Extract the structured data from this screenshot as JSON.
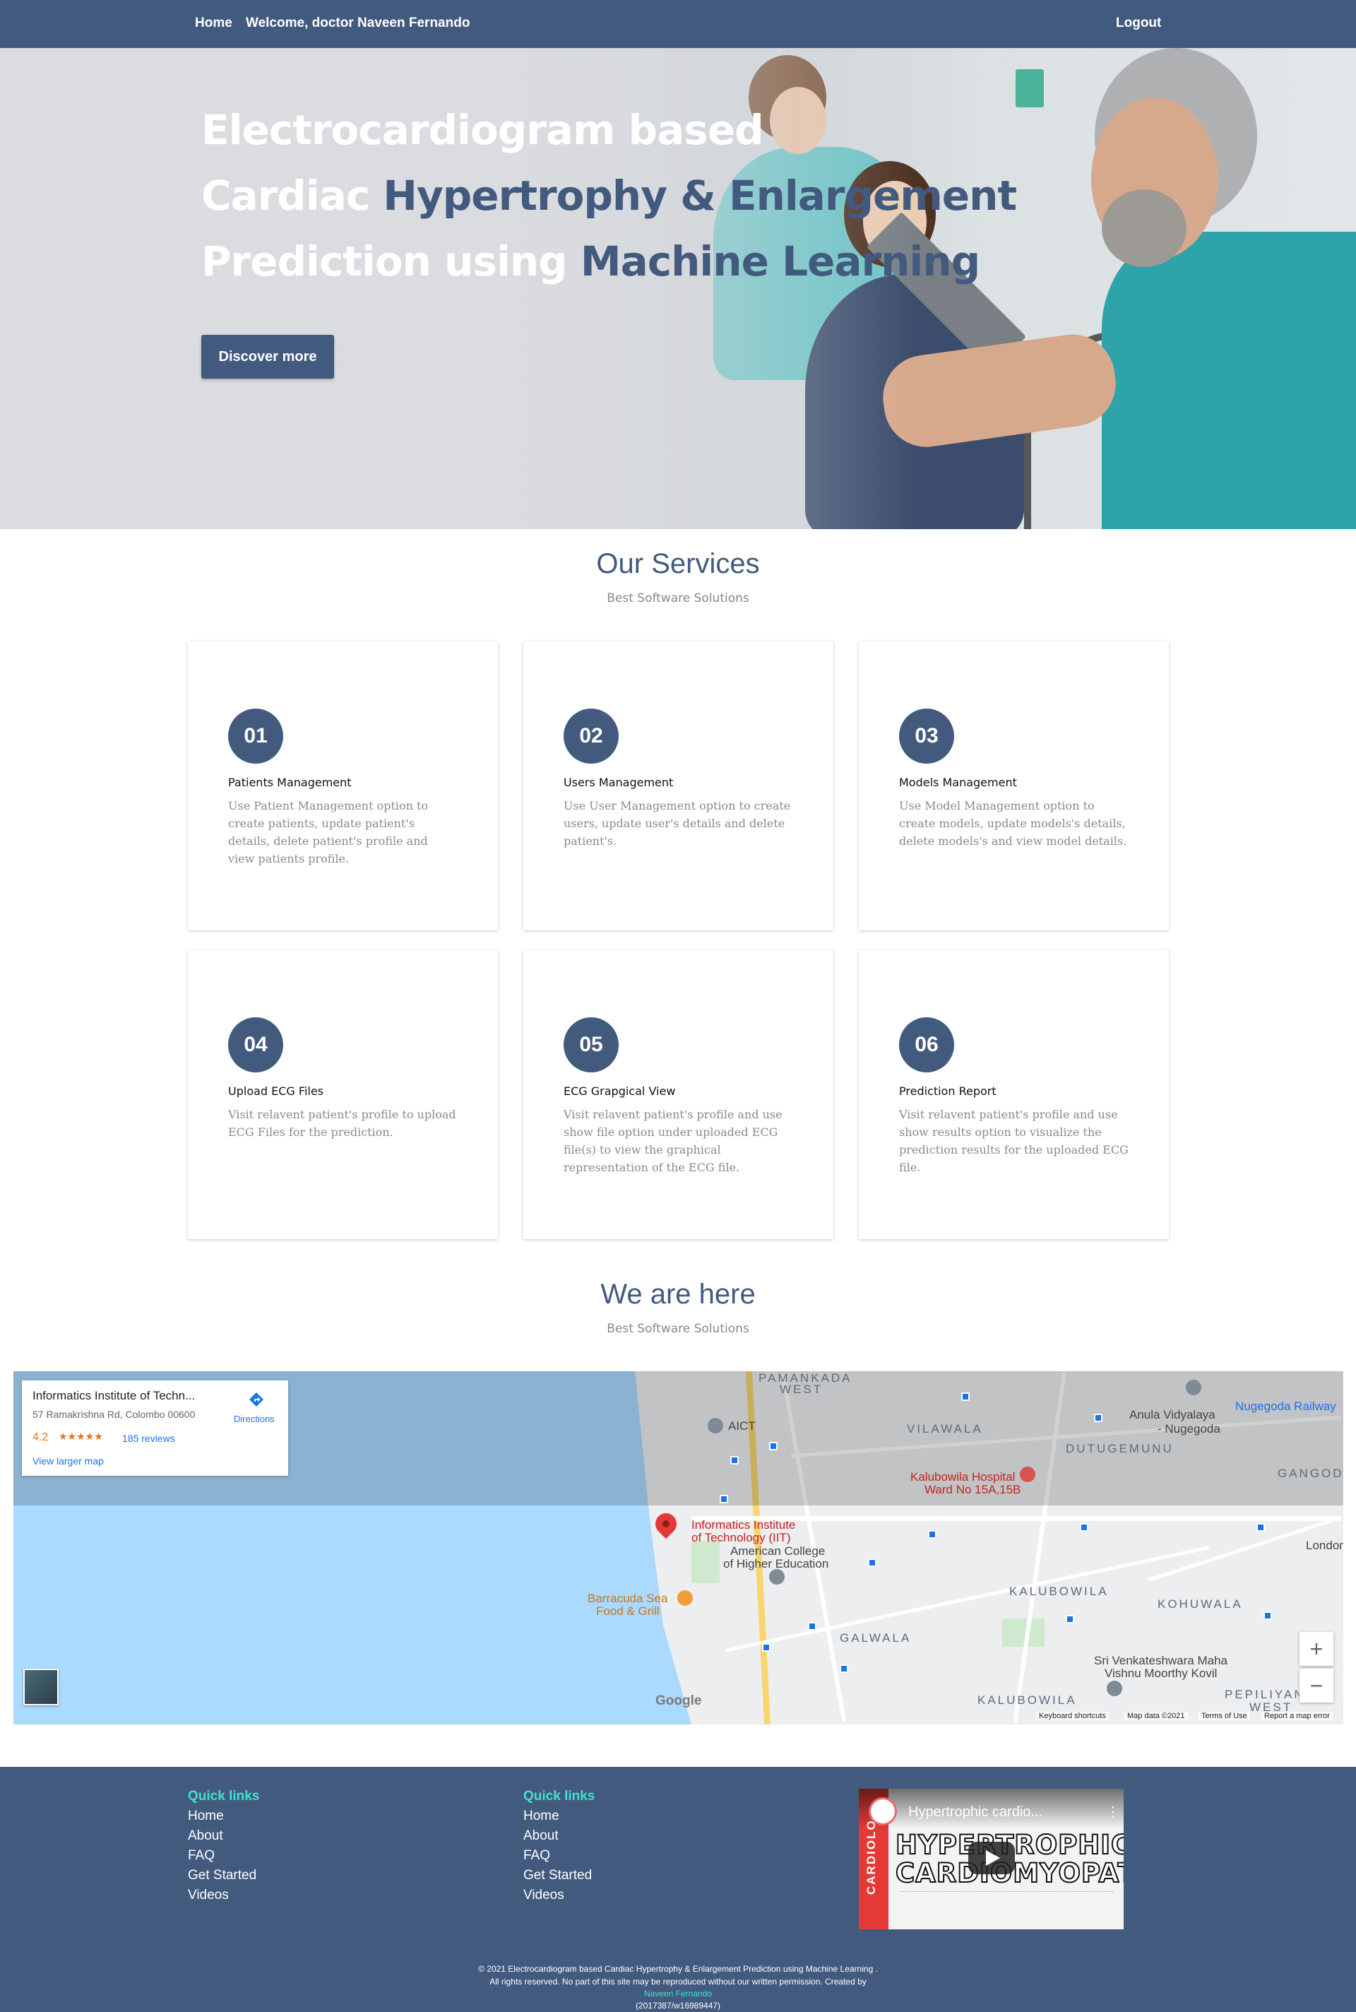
{
  "nav": {
    "home": "Home",
    "welcome": "Welcome, doctor Naveen Fernando",
    "logout": "Logout"
  },
  "hero": {
    "line1": "Electrocardiogram based",
    "line2_a": "Cardiac ",
    "line2_b": "Hypertrophy & Enlargement",
    "line3_a": "Prediction using ",
    "line3_b": "Machine Learning",
    "button": "Discover more"
  },
  "services": {
    "title": "Our Services",
    "subtitle": "Best Software Solutions",
    "cards": [
      {
        "num": "01",
        "title": "Patients Management",
        "desc": "Use Patient Management option to create patients, update patient's details, delete patient's profile and view patients profile."
      },
      {
        "num": "02",
        "title": "Users Management",
        "desc": "Use User Management option to create users, update user's details and delete patient's."
      },
      {
        "num": "03",
        "title": "Models Management",
        "desc": "Use Model Management option to create models, update models's details, delete models's and view model details."
      },
      {
        "num": "04",
        "title": "Upload ECG Files",
        "desc": "Visit relavent patient's profile to upload ECG Files for the prediction."
      },
      {
        "num": "05",
        "title": "ECG Grapgical View",
        "desc": "Visit relavent patient's profile and use show file option under uploaded ECG file(s) to view the graphical representation of the ECG file."
      },
      {
        "num": "06",
        "title": "Prediction Report",
        "desc": "Visit relavent patient's profile and use show results option to visualize the prediction results for the uploaded ECG file."
      }
    ]
  },
  "location": {
    "title": "We are here",
    "subtitle": "Best Software Solutions"
  },
  "map": {
    "place_name": "Informatics Institute of Techn...",
    "address": "57 Ramakrishna Rd, Colombo 00600",
    "rating": "4.2",
    "stars": "★★★★★",
    "reviews": "185 reviews",
    "view_larger": "View larger map",
    "directions": "Directions",
    "directions_icon": "directions-icon",
    "pin_label_1": "Informatics Institute",
    "pin_label_2": "of Technology (IIT)",
    "labels": {
      "pamankada": "PAMANKADA",
      "west": "WEST",
      "vilawala": "VILAWALA",
      "dutugemunu": "DUTUGEMUNU",
      "gangodaw": "GANGODAW",
      "kalubowila": "KALUBOWILA",
      "kohuwala": "KOHUWALA",
      "galwala": "GALWALA",
      "kalubowila2": "KALUBOWILA",
      "pepiliyana": "PEPILIYANA",
      "west2": "WEST",
      "londontec": "Londontec",
      "anula": "Anula Vidyalaya",
      "nugegoda": "- Nugegoda",
      "nugegoda_rail": "Nugegoda Railway",
      "hospital_1": "Kalubowila Hospital",
      "hospital_2": "Ward No 15A,15B",
      "american_1": "American College",
      "american_2": "of Higher Education",
      "barracuda_1": "Barracuda Sea",
      "barracuda_2": "Food & Grill",
      "aict": "AICT",
      "venkat_1": "Sri Venkateshwara Maha",
      "venkat_2": "Vishnu Moorthy Kovil"
    },
    "google": "Google",
    "keyboard": "Keyboard shortcuts",
    "map_data": "Map data ©2021",
    "terms": "Terms of Use",
    "report": "Report a map error",
    "zoom_in": "+",
    "zoom_out": "−"
  },
  "footer": {
    "col1": {
      "title": "Quick links",
      "links": [
        "Home",
        "About",
        "FAQ",
        "Get Started",
        "Videos"
      ]
    },
    "col2": {
      "title": "Quick links",
      "links": [
        "Home",
        "About",
        "FAQ",
        "Get Started",
        "Videos"
      ]
    },
    "video": {
      "title": "Hypertrophic cardio...",
      "big_1": "HYPERTROPHIC",
      "big_2": "CARDIOMYOPATHY",
      "side": "CARDIOLO",
      "menu": "⋮"
    },
    "copyright_1": "© 2021 Electrocardiogram based Cardiac Hypertrophy & Enlargement Prediction using Machine Learning .",
    "copyright_2": "All rights reserved. No part of this site may be reproduced without our written permission. Created by",
    "author": "Naveen Fernando",
    "id": "(2017387/w16989447)"
  }
}
